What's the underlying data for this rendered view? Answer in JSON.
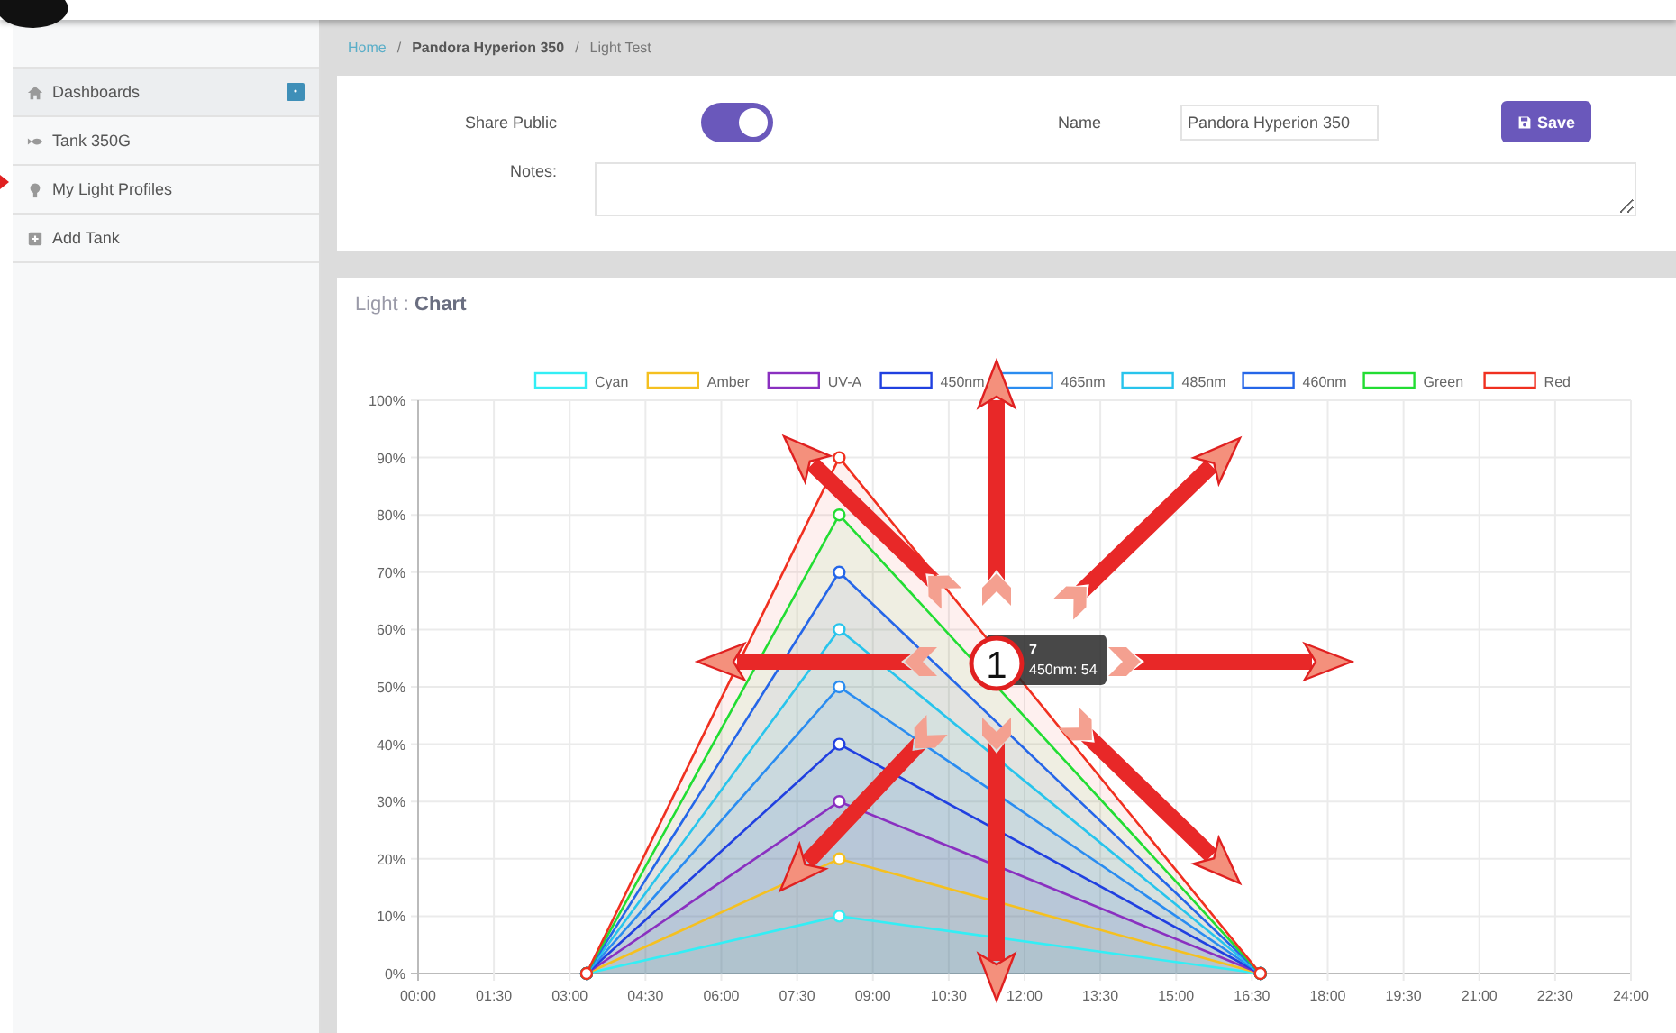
{
  "sidebar": {
    "items": [
      {
        "label": "Dashboards",
        "kind": "home",
        "selected": true,
        "badge": true
      },
      {
        "label": "Tank 350G",
        "kind": "fish",
        "selected": false,
        "badge": false
      },
      {
        "label": "My Light Profiles",
        "kind": "bulb",
        "selected": false,
        "badge": false
      },
      {
        "label": "Add Tank",
        "kind": "plus",
        "selected": false,
        "badge": false
      }
    ]
  },
  "breadcrumb": [
    {
      "label": "Home",
      "kind": "link"
    },
    {
      "label": "/",
      "kind": "sep"
    },
    {
      "label": "Pandora Hyperion 350",
      "kind": "bold"
    },
    {
      "label": "/",
      "kind": "sep"
    },
    {
      "label": "Light Test",
      "kind": "plain"
    }
  ],
  "form": {
    "share_public": {
      "label": "Share Public",
      "on": true
    },
    "name": {
      "label": "Name",
      "value": "Pandora Hyperion 350"
    },
    "save_button": {
      "label": "Save"
    },
    "notes": {
      "label": "Notes:"
    }
  },
  "chart_card": {
    "title": "Light : **Chart**",
    "chart_data": {
      "type": "area",
      "grid": true,
      "legend": true,
      "x": [
        3.333,
        8.333,
        16.667
      ],
      "xlim": [
        0,
        24
      ],
      "ylim": [
        0,
        100
      ],
      "xticks": [
        {
          "value": 0,
          "label": "00:00"
        },
        {
          "value": 1.5,
          "label": "01:30"
        },
        {
          "value": 3,
          "label": "03:00"
        },
        {
          "value": 4.5,
          "label": "04:30"
        },
        {
          "value": 6,
          "label": "06:00"
        },
        {
          "value": 7.5,
          "label": "07:30"
        },
        {
          "value": 9,
          "label": "09:00"
        },
        {
          "value": 10.5,
          "label": "10:30"
        },
        {
          "value": 12,
          "label": "12:00"
        },
        {
          "value": 13.5,
          "label": "13:30"
        },
        {
          "value": 15,
          "label": "15:00"
        },
        {
          "value": 16.5,
          "label": "16:30"
        },
        {
          "value": 18,
          "label": "18:00"
        },
        {
          "value": 19.5,
          "label": "19:30"
        },
        {
          "value": 21,
          "label": "21:00"
        },
        {
          "value": 22.5,
          "label": "22:30"
        },
        {
          "value": 24,
          "label": "24:00"
        }
      ],
      "yticks": [
        {
          "value": 0,
          "label": "0%"
        },
        {
          "value": 10,
          "label": "10%"
        },
        {
          "value": 20,
          "label": "20%"
        },
        {
          "value": 30,
          "label": "30%"
        },
        {
          "value": 40,
          "label": "40%"
        },
        {
          "value": 50,
          "label": "50%"
        },
        {
          "value": 60,
          "label": "60%"
        },
        {
          "value": 70,
          "label": "70%"
        },
        {
          "value": 80,
          "label": "80%"
        },
        {
          "value": 90,
          "label": "90%"
        },
        {
          "value": 100,
          "label": "100%"
        }
      ],
      "series": [
        {
          "name": "Cyan",
          "color": "#33eef5",
          "values": [
            0,
            10,
            0
          ]
        },
        {
          "name": "Amber",
          "color": "#f5c020",
          "values": [
            0,
            20,
            0
          ]
        },
        {
          "name": "UV-A",
          "color": "#8a30c0",
          "values": [
            0,
            30,
            0
          ]
        },
        {
          "name": "450nm",
          "color": "#2040e0",
          "values": [
            0,
            40,
            0
          ]
        },
        {
          "name": "465nm",
          "color": "#2a8cf0",
          "values": [
            0,
            50,
            0
          ]
        },
        {
          "name": "485nm",
          "color": "#28c4ec",
          "values": [
            0,
            60,
            0
          ]
        },
        {
          "name": "460nm",
          "color": "#2566e8",
          "values": [
            0,
            70,
            0
          ]
        },
        {
          "name": "Green",
          "color": "#22dd33",
          "values": [
            0,
            80,
            0
          ]
        },
        {
          "name": "Red",
          "color": "#f03020",
          "values": [
            0,
            90,
            0
          ]
        }
      ]
    },
    "tooltip": {
      "title": "7",
      "line": "450nm: 54"
    }
  },
  "callout": {
    "label": "1"
  }
}
